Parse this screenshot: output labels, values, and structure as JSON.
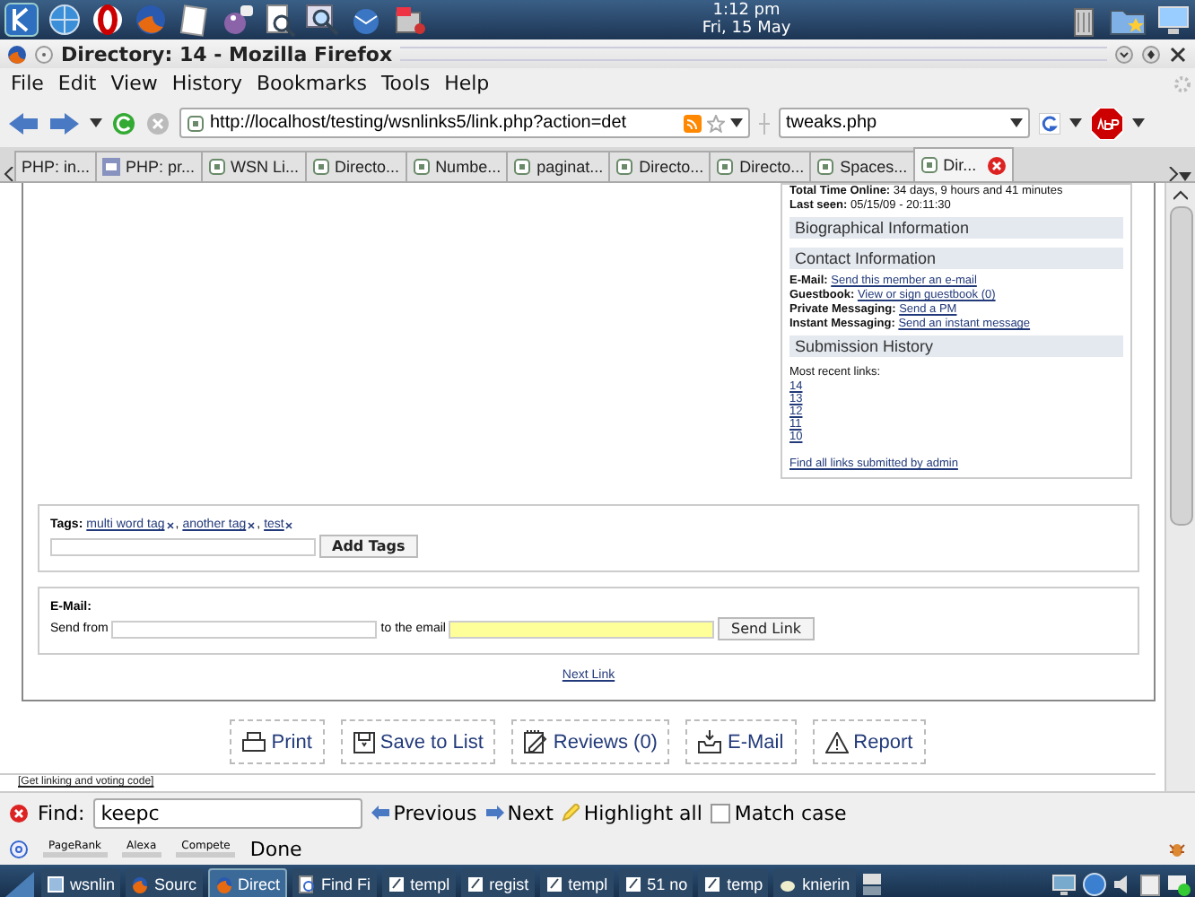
{
  "desktop_panel": {
    "time": "1:12 pm",
    "date": "Fri, 15 May"
  },
  "window": {
    "title": "Directory: 14 - Mozilla Firefox"
  },
  "menu": [
    {
      "label": "File"
    },
    {
      "label": "Edit"
    },
    {
      "label": "View"
    },
    {
      "label": "History"
    },
    {
      "label": "Bookmarks"
    },
    {
      "label": "Tools"
    },
    {
      "label": "Help"
    }
  ],
  "navigation": {
    "url": "http://localhost/testing/wsnlinks5/link.php?action=det",
    "search": "tweaks.php"
  },
  "tabs": [
    {
      "label": "PHP: in...",
      "kind": "plain",
      "selected": false
    },
    {
      "label": "PHP: pr...",
      "kind": "php",
      "selected": false
    },
    {
      "label": "WSN Li...",
      "kind": "page",
      "selected": false
    },
    {
      "label": "Directo...",
      "kind": "page",
      "selected": false
    },
    {
      "label": "Numbe...",
      "kind": "page",
      "selected": false
    },
    {
      "label": "paginat...",
      "kind": "page",
      "selected": false
    },
    {
      "label": "Directo...",
      "kind": "page",
      "selected": false
    },
    {
      "label": "Directo...",
      "kind": "page",
      "selected": false
    },
    {
      "label": "Spaces...",
      "kind": "page",
      "selected": false
    },
    {
      "label": "Dir...",
      "kind": "page",
      "selected": true
    }
  ],
  "profile": [
    {
      "kind": "stat",
      "label": "Total Time Online:",
      "value": "34 days, 9 hours and 41 minutes"
    },
    {
      "kind": "stat",
      "label": "Last seen:",
      "value": "05/15/09 - 20:11:30"
    },
    {
      "kind": "heading",
      "text": "Biographical Information"
    },
    {
      "kind": "heading",
      "text": "Contact Information"
    },
    {
      "kind": "field",
      "label": "E-Mail:",
      "value": "Send this member an e-mail"
    },
    {
      "kind": "field",
      "label": "Guestbook:",
      "value": "View or sign guestbook (0)"
    },
    {
      "kind": "field",
      "label": "Private Messaging:",
      "value": "Send a PM"
    },
    {
      "kind": "field",
      "label": "Instant Messaging:",
      "value": "Send an instant message"
    },
    {
      "kind": "heading",
      "text": "Submission History"
    },
    {
      "kind": "note",
      "text": "Most recent links:"
    },
    {
      "kind": "link",
      "text": "14"
    },
    {
      "kind": "link",
      "text": "13"
    },
    {
      "kind": "link",
      "text": "12"
    },
    {
      "kind": "link",
      "text": "11"
    },
    {
      "kind": "link",
      "text": "10"
    },
    {
      "kind": "all-link",
      "text": "Find all links submitted by admin"
    }
  ],
  "tags": {
    "label": "Tags:",
    "items": [
      "multi word tag",
      "another tag",
      "test"
    ],
    "separator": ",",
    "button": "Add Tags"
  },
  "email": {
    "label": "E-Mail:",
    "from_label": "Send from",
    "to_label": "to the email",
    "to_highlighted": true,
    "button": "Send Link"
  },
  "next_link": "Next Link",
  "actions": [
    {
      "label": "Print",
      "kind": "print"
    },
    {
      "label": "Save to List",
      "kind": "save"
    },
    {
      "label": "Reviews (0)",
      "kind": "reviews"
    },
    {
      "label": "E-Mail",
      "kind": "mail"
    },
    {
      "label": "Report",
      "kind": "report"
    }
  ],
  "code_link": "[Get linking and voting code]",
  "find_bar": {
    "label": "Find:",
    "value": "keepc",
    "previous": "Previous",
    "next": "Next",
    "highlight_all": "Highlight all",
    "match_case": {
      "label": "Match case",
      "checked": false
    }
  },
  "status_bar": {
    "plugins": [
      "PageRank",
      "Alexa",
      "Compete"
    ],
    "status": "Done"
  },
  "taskbar": [
    {
      "label": "wsnlin",
      "kind": "window",
      "selected": false
    },
    {
      "label": "Sourc",
      "kind": "browser",
      "selected": false
    },
    {
      "label": "Direct",
      "kind": "browser",
      "selected": true
    },
    {
      "label": "Find Fi",
      "kind": "search",
      "selected": false
    },
    {
      "label": "templ",
      "kind": "editor",
      "selected": false
    },
    {
      "label": "regist",
      "kind": "editor",
      "selected": false
    },
    {
      "label": "templ",
      "kind": "editor",
      "selected": false
    },
    {
      "label": "51 no",
      "kind": "editor",
      "selected": false
    },
    {
      "label": "temp",
      "kind": "editor",
      "selected": false
    },
    {
      "label": "knierin",
      "kind": "hand",
      "selected": false
    }
  ]
}
